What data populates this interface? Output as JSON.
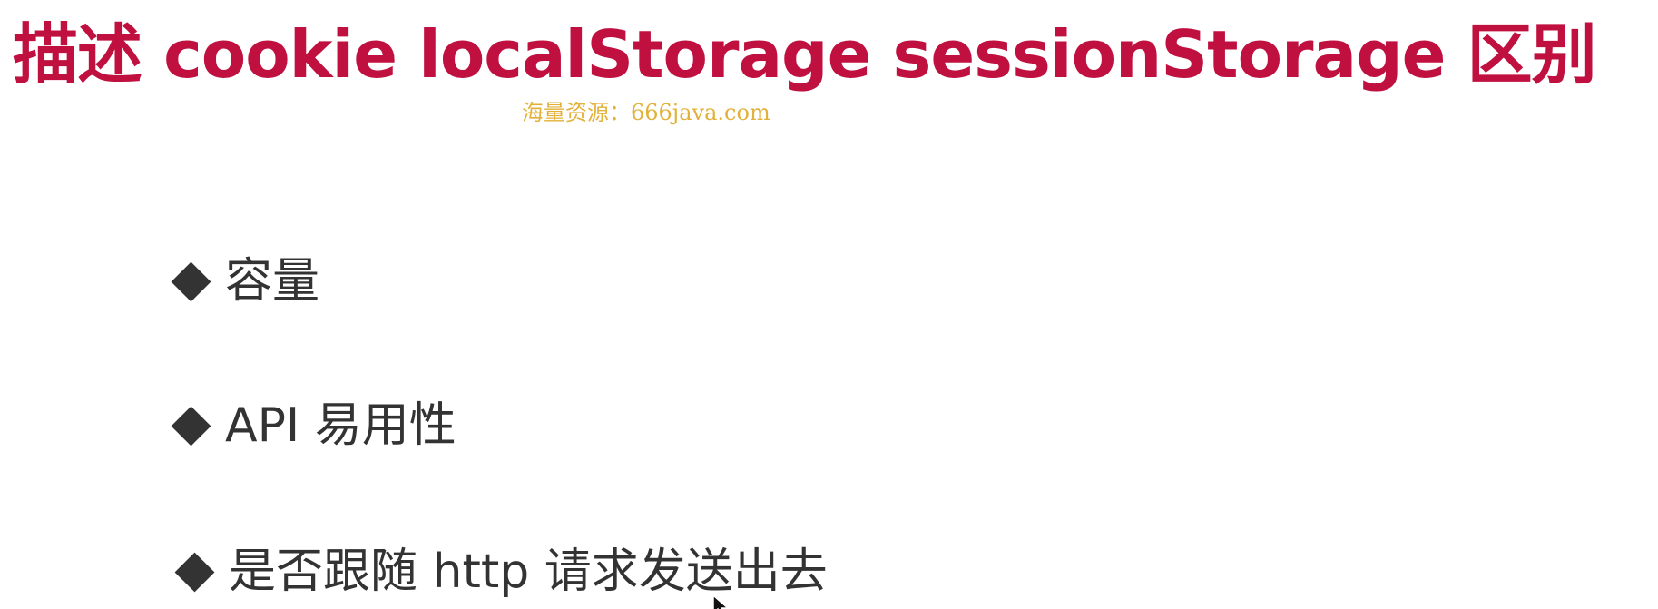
{
  "slide": {
    "title": "描述 cookie localStorage sessionStorage 区别",
    "watermark": "海量资源：666java.com",
    "bullets": [
      {
        "text": "容量"
      },
      {
        "text": "API 易用性"
      },
      {
        "text": "是否跟随 http 请求发送出去"
      }
    ],
    "colors": {
      "title": "#c0103f",
      "watermark": "#e2b13a",
      "bullet": "#333333"
    },
    "icons": {
      "bullet": "diamond-icon",
      "cursor": "mouse-pointer-icon"
    }
  }
}
